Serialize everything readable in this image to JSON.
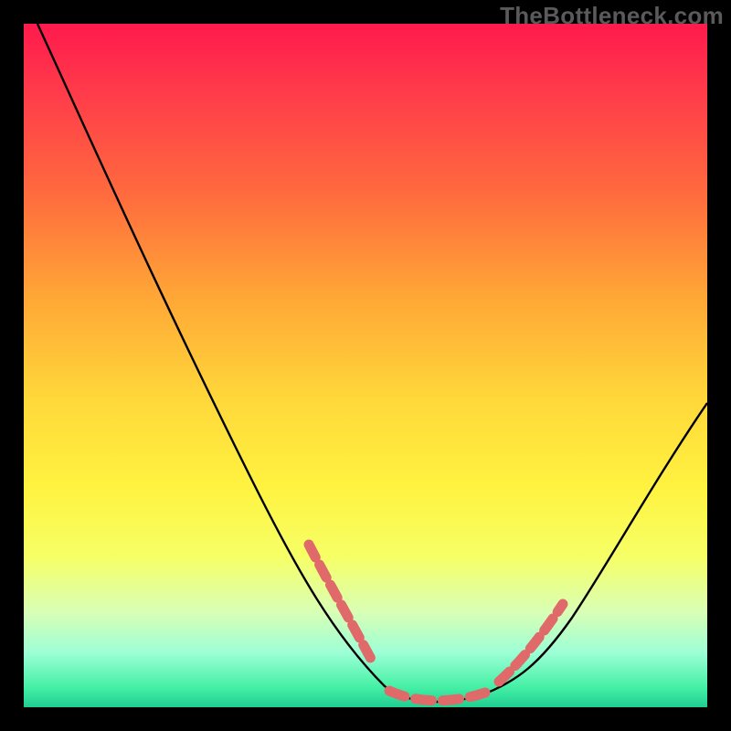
{
  "watermark": "TheBottleneck.com",
  "chart_data": {
    "type": "line",
    "title": "",
    "xlabel": "",
    "ylabel": "",
    "xlim": [
      0,
      100
    ],
    "ylim": [
      0,
      100
    ],
    "grid": false,
    "series": [
      {
        "name": "bottleneck-curve",
        "x": [
          2,
          8,
          14,
          20,
          26,
          32,
          38,
          44,
          48,
          52,
          55,
          58,
          62,
          66,
          72,
          78,
          84,
          90,
          96,
          100
        ],
        "y": [
          100,
          90,
          79,
          68,
          57,
          45,
          33,
          21,
          12,
          6,
          2,
          0,
          0,
          1,
          5,
          14,
          25,
          36,
          48,
          56
        ]
      }
    ],
    "markers": [
      {
        "name": "salmon-segment-left",
        "x_range": [
          42,
          52
        ],
        "y_range": [
          24,
          5
        ]
      },
      {
        "name": "salmon-segment-floor",
        "x_range": [
          54,
          67
        ],
        "y_range": [
          1,
          2
        ]
      },
      {
        "name": "salmon-segment-right",
        "x_range": [
          68,
          78
        ],
        "y_range": [
          3,
          17
        ]
      }
    ],
    "colors": {
      "curve": "#000000",
      "marker": "#e06a6a",
      "background_top": "#ff1a4d",
      "background_bottom": "#1fcf91"
    }
  }
}
